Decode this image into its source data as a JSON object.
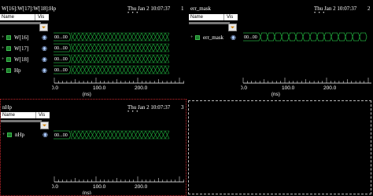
{
  "panes": [
    {
      "id": "pane1",
      "title": "W[16]:W[17]:W[18]:Hp",
      "time": "Thu Jan 2 10:07:37",
      "number": "1",
      "dots": "• • •",
      "col_name": "Name",
      "col_vis": "Vis",
      "signals": [
        {
          "name": "W[16]",
          "value": "00...00",
          "type": "bus"
        },
        {
          "name": "W[17]",
          "value": "00...00",
          "type": "bus"
        },
        {
          "name": "W[18]",
          "value": "00...00",
          "type": "bus"
        },
        {
          "name": "Hp",
          "value": "00...00",
          "type": "bus"
        }
      ],
      "axis": {
        "ticks": [
          "0.0",
          "100.0",
          "200.0"
        ],
        "unit": "(ns)"
      }
    },
    {
      "id": "pane2",
      "title": "err_mask",
      "time": "Thu Jan 2 10:07:37",
      "number": "2",
      "dots": "• • •",
      "col_name": "Name",
      "col_vis": "Vis",
      "signals": [
        {
          "name": "err_mask",
          "value": "00...00",
          "type": "dashbus"
        }
      ],
      "axis": {
        "ticks": [
          "0.0",
          "100.0",
          "200.0"
        ],
        "unit": "(ns)"
      }
    },
    {
      "id": "pane3",
      "title": "nHp",
      "time": "Thu Jan 2 10:07:37",
      "number": "3",
      "dots": "• • •",
      "col_name": "Name",
      "col_vis": "Vis",
      "signals": [
        {
          "name": "nHp",
          "value": "00...00",
          "type": "bus"
        }
      ],
      "axis": {
        "ticks": [
          "0.0",
          "100.0",
          "200.0"
        ],
        "unit": "(ns)"
      }
    }
  ],
  "icons": {
    "filter": "filter-funnel-icon",
    "visibility": "eye-icon",
    "expand": "expand-plus-icon",
    "signal": "bus-signal-icon"
  },
  "colors": {
    "wave": "#1fa33a",
    "selected_border": "#c0262c",
    "background": "#000000"
  }
}
